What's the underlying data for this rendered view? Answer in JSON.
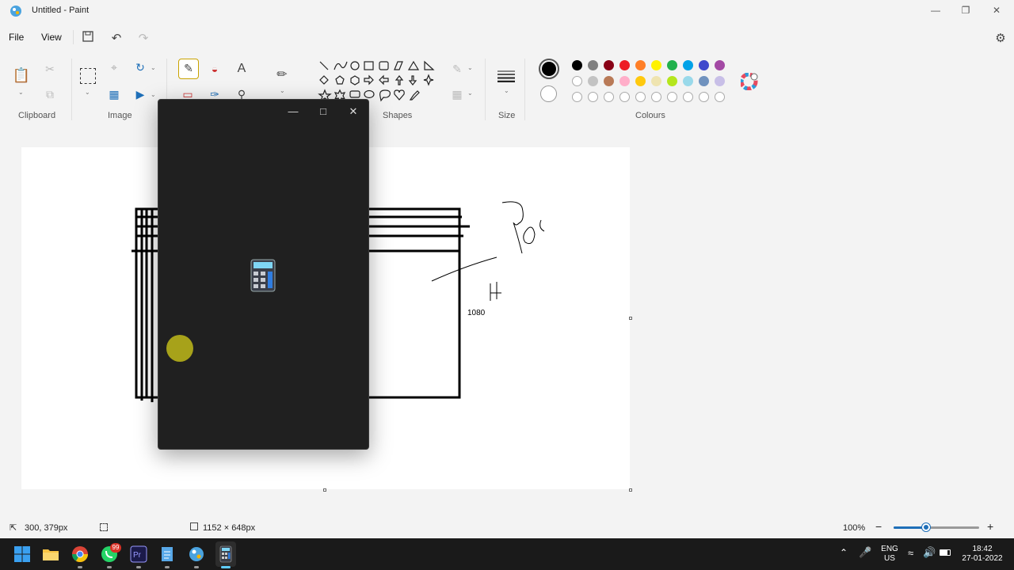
{
  "window": {
    "title": "Untitled - Paint"
  },
  "menu": {
    "file": "File",
    "view": "View"
  },
  "groups": {
    "clipboard": "Clipboard",
    "image": "Image",
    "shapes": "Shapes",
    "size": "Size",
    "colours": "Colours"
  },
  "colors": {
    "accent": "#c9a300",
    "primary": "#000000",
    "secondary": "#ffffff",
    "row1": [
      "#000000",
      "#7f7f7f",
      "#880015",
      "#ed1c24",
      "#ff7f27",
      "#fff200",
      "#22b14c",
      "#00a2e8",
      "#3f48cc",
      "#a349a4"
    ],
    "row2": [
      "#ffffff",
      "#c3c3c3",
      "#b97a57",
      "#ffaec9",
      "#ffc90e",
      "#efe4b0",
      "#b5e61d",
      "#99d9ea",
      "#7092be",
      "#c8bfe7"
    ]
  },
  "canvas": {
    "annotation": "1080"
  },
  "status": {
    "cursor": "300, 379px",
    "canvas_size": "1152 × 648px",
    "zoom": "100%"
  },
  "taskbar": {
    "whatsapp_badge": "99",
    "lang_line1": "ENG",
    "lang_line2": "US",
    "time": "18:42",
    "date": "27-01-2022"
  },
  "calculator": {
    "icon": "calculator-icon"
  }
}
